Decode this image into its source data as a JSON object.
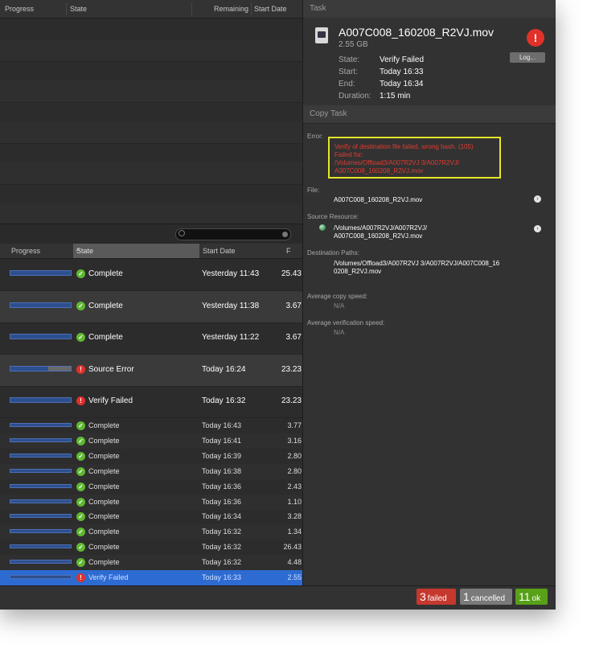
{
  "upper_table": {
    "col_progress": "Progress",
    "col_state": "State",
    "col_remaining": "Remaining",
    "col_start_date": "Start Date"
  },
  "lower_table": {
    "col_progress": "Progress",
    "col_state": "State",
    "col_start_date": "Start Date",
    "col_f": "F",
    "large_rows": [
      {
        "state": "Complete",
        "status": "ok",
        "date": "Yesterday 11:43",
        "size": "25.43",
        "progress": 1.0
      },
      {
        "state": "Complete",
        "status": "ok",
        "date": "Yesterday 11:38",
        "size": "3.67",
        "progress": 1.0
      },
      {
        "state": "Complete",
        "status": "ok",
        "date": "Yesterday 11:22",
        "size": "3.67",
        "progress": 1.0
      },
      {
        "state": "Source Error",
        "status": "err",
        "date": "Today 16:24",
        "size": "23.23",
        "progress": 0.62
      },
      {
        "state": "Verify Failed",
        "status": "err",
        "date": "Today 16:32",
        "size": "23.23",
        "progress": 1.0
      }
    ],
    "small_rows": [
      {
        "state": "Complete",
        "status": "ok",
        "date": "Today 16:43",
        "size": "3.77"
      },
      {
        "state": "Complete",
        "status": "ok",
        "date": "Today 16:41",
        "size": "3.16"
      },
      {
        "state": "Complete",
        "status": "ok",
        "date": "Today 16:39",
        "size": "2.80"
      },
      {
        "state": "Complete",
        "status": "ok",
        "date": "Today 16:38",
        "size": "2.80"
      },
      {
        "state": "Complete",
        "status": "ok",
        "date": "Today 16:36",
        "size": "2.43"
      },
      {
        "state": "Complete",
        "status": "ok",
        "date": "Today 16:36",
        "size": "1.10"
      },
      {
        "state": "Complete",
        "status": "ok",
        "date": "Today 16:34",
        "size": "3.28"
      },
      {
        "state": "Complete",
        "status": "ok",
        "date": "Today 16:32",
        "size": "1.34"
      },
      {
        "state": "Complete",
        "status": "ok",
        "date": "Today 16:32",
        "size": "26.43"
      },
      {
        "state": "Complete",
        "status": "ok",
        "date": "Today 16:32",
        "size": "4.48"
      },
      {
        "state": "Verify Failed",
        "status": "err",
        "date": "Today 16:33",
        "size": "2.55",
        "selected": true
      }
    ]
  },
  "task": {
    "header": "Task",
    "file_name": "A007C008_160208_R2VJ.mov",
    "file_size": "2.55 GB",
    "log_button": "Log...",
    "state_label": "State:",
    "state_value": "Verify Failed",
    "start_label": "Start:",
    "start_value": "Today 16:33",
    "end_label": "End:",
    "end_value": "Today 16:34",
    "duration_label": "Duration:",
    "duration_value": "1:15 min"
  },
  "copy_task": {
    "header": "Copy Task",
    "error_label": "Error:",
    "error_lines": [
      "Verify of destination file failed, wrong hash. (105)",
      "Failed for:",
      "/Volumes/Offload3/A007R2VJ 3/A007R2VJ/",
      "A007C008_160208_R2VJ.mov"
    ],
    "file_label": "File:",
    "file_value": "A007C008_160208_R2VJ.mov",
    "source_label": "Source Resource:",
    "source_lines": [
      "/Volumes/A007R2VJ/A007R2VJ/",
      "A007C008_160208_R2VJ.mov"
    ],
    "dest_label": "Destination Paths:",
    "dest_lines": [
      "/Volumes/Offload3/A007R2VJ 3/A007R2VJ/A007C008_16",
      "0208_R2VJ.mov"
    ],
    "avg_copy_label": "Average copy speed:",
    "avg_copy_value": "N/A",
    "avg_verify_label": "Average verification speed:",
    "avg_verify_value": "N/A"
  },
  "status_bar": {
    "failed_count": "3",
    "failed_label": "failed",
    "cancelled_count": "1",
    "cancelled_label": "cancelled",
    "ok_count": "11",
    "ok_label": "ok"
  },
  "icons": {
    "ok": "checkmark-icon",
    "err": "exclamation-icon",
    "file": "movie-file-icon",
    "disk": "disk-icon",
    "reveal": "arrow-right-circle-icon"
  },
  "colors": {
    "ok": "#5fb832",
    "error": "#e0312a",
    "highlight_box": "#e6e62a",
    "selection": "#2d6bd2",
    "ok_badge": "#58a018",
    "failed_badge": "#c5382e"
  }
}
